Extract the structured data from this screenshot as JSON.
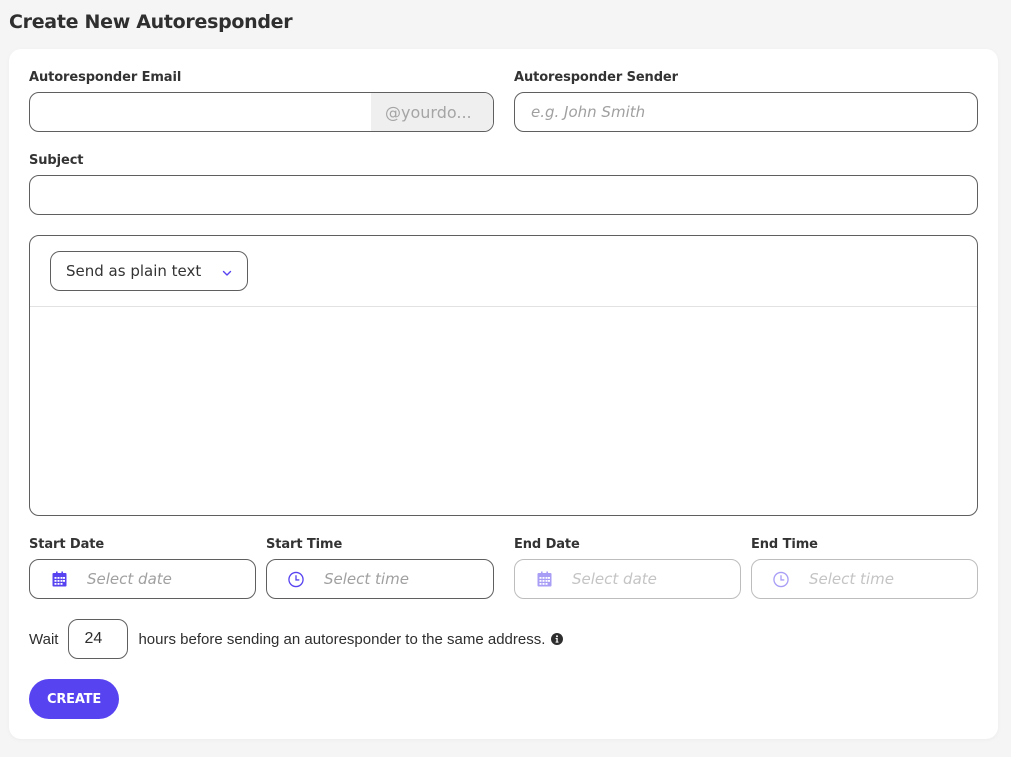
{
  "page": {
    "title": "Create New Autoresponder"
  },
  "form": {
    "email": {
      "label": "Autoresponder Email",
      "value": "",
      "placeholder": "",
      "domain_suffix": "@yourdo..."
    },
    "sender": {
      "label": "Autoresponder Sender",
      "value": "",
      "placeholder": "e.g. John Smith"
    },
    "subject": {
      "label": "Subject",
      "value": "",
      "placeholder": ""
    },
    "editor": {
      "format_selected": "Send as plain text",
      "format_icon": "chevron-down-icon",
      "body": ""
    },
    "start_date": {
      "label": "Start Date",
      "placeholder": "Select date",
      "icon": "calendar-icon"
    },
    "start_time": {
      "label": "Start Time",
      "placeholder": "Select time",
      "icon": "clock-icon"
    },
    "end_date": {
      "label": "End Date",
      "placeholder": "Select date",
      "icon": "calendar-icon",
      "disabled": true
    },
    "end_time": {
      "label": "End Time",
      "placeholder": "Select time",
      "icon": "clock-icon",
      "disabled": true
    },
    "wait": {
      "prefix": "Wait",
      "value": "24",
      "suffix": "hours before sending an autoresponder to the same address.",
      "info_icon": "info-icon"
    },
    "create_label": "CREATE"
  },
  "colors": {
    "accent": "#5743f0",
    "background": "#f5f5f5",
    "card": "#ffffff",
    "border": "#5f5f5f",
    "suffix_bg": "#efefef"
  }
}
